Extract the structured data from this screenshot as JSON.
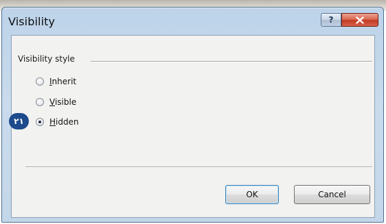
{
  "window": {
    "title": "Visibility",
    "help_glyph": "?",
    "close_icon": "close-icon"
  },
  "group": {
    "title": "Visibility style"
  },
  "options": [
    {
      "label": "Inherit",
      "accel": "I",
      "rest": "nherit",
      "selected": false
    },
    {
      "label": "Visible",
      "accel": "V",
      "rest": "isible",
      "selected": false
    },
    {
      "label": "Hidden",
      "accel": "H",
      "rest": "idden",
      "selected": true
    }
  ],
  "callout": {
    "text": "٢١"
  },
  "buttons": {
    "ok": "OK",
    "cancel": "Cancel"
  },
  "colors": {
    "titlebar": "#c4d7ea",
    "close_button": "#c23a22",
    "callout": "#1d4a8c"
  }
}
